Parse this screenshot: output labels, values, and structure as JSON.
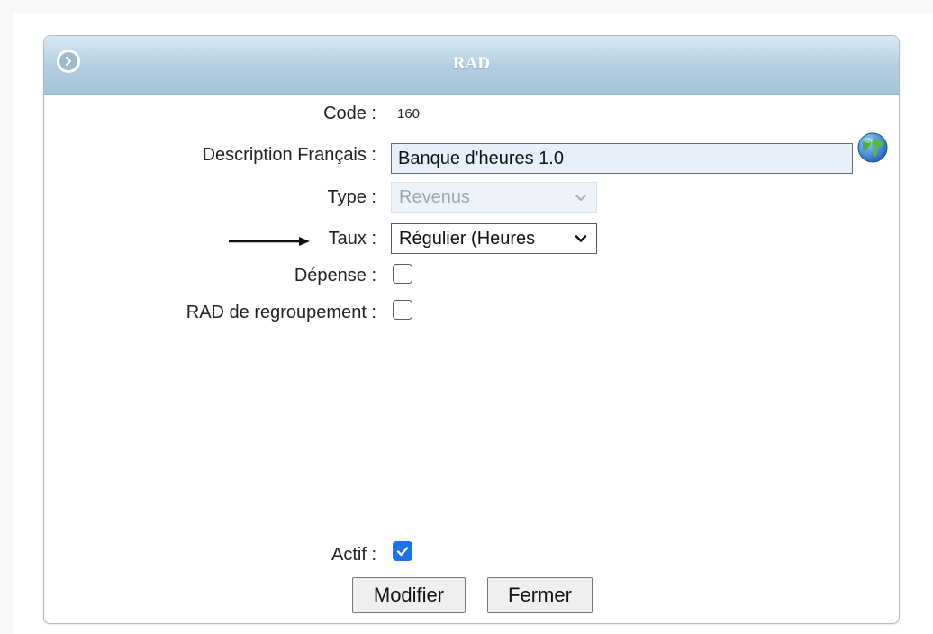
{
  "dialog": {
    "title": "RAD",
    "title_icon": "chevron-right-circle-icon"
  },
  "form": {
    "code": {
      "label": "Code :",
      "value": "160"
    },
    "description": {
      "label": "Description Français :",
      "value": "Banque d'heures 1.0",
      "icon": "globe-icon"
    },
    "type": {
      "label": "Type :",
      "value": "Revenus",
      "disabled": true
    },
    "taux": {
      "label": "Taux :",
      "value": "Régulier (Heures"
    },
    "depense": {
      "label": "Dépense :",
      "checked": false
    },
    "regroupement": {
      "label": "RAD de regroupement :",
      "checked": false
    },
    "actif": {
      "label": "Actif :",
      "checked": true
    }
  },
  "buttons": {
    "modifier": "Modifier",
    "fermer": "Fermer"
  },
  "colors": {
    "titlebar": "#b5cfe2",
    "checkbox_checked": "#1a73e8",
    "input_bg": "#e6effa"
  }
}
